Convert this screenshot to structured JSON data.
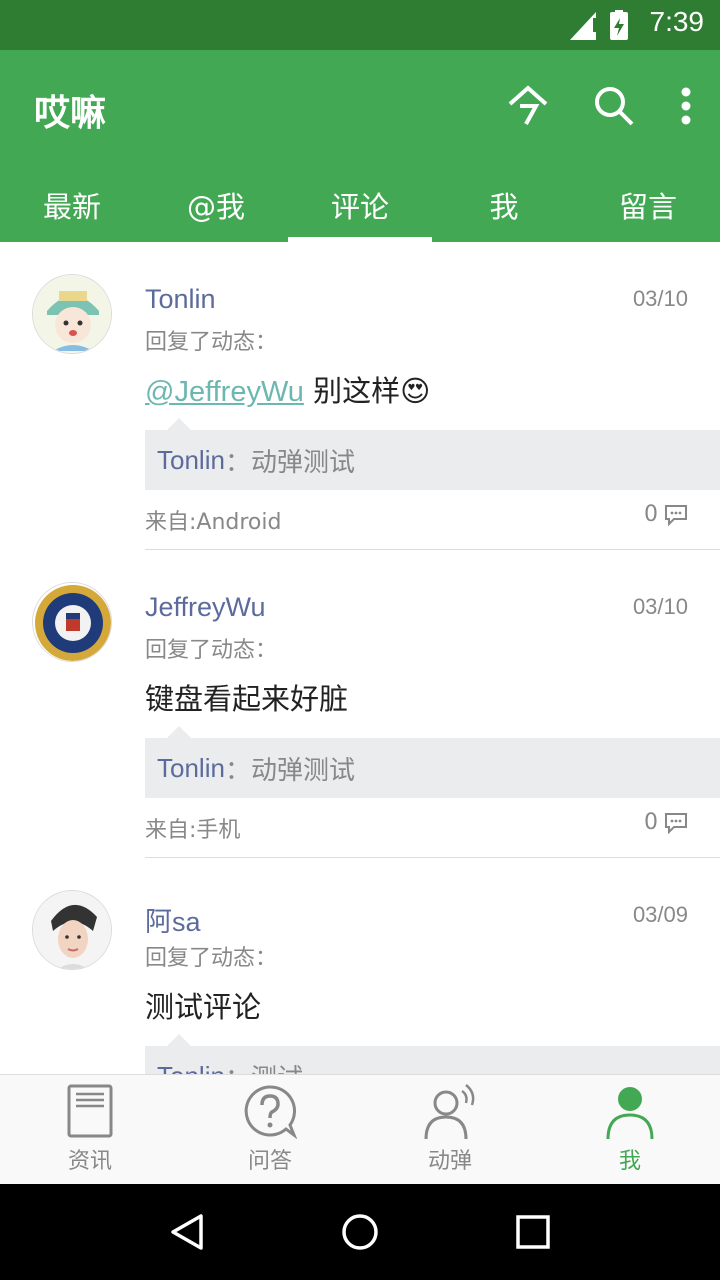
{
  "status_bar": {
    "time": "7:39"
  },
  "app_bar": {
    "title": "哎嘛",
    "actions": [
      {
        "icon": "today-icon",
        "label": "今"
      },
      {
        "icon": "search-icon"
      },
      {
        "icon": "more-vert-icon"
      }
    ]
  },
  "tabs": [
    {
      "label": "最新"
    },
    {
      "label": "@我"
    },
    {
      "label": "评论",
      "active": true
    },
    {
      "label": "我"
    },
    {
      "label": "留言"
    }
  ],
  "feed": [
    {
      "name": "Tonlin",
      "date": "03/10",
      "action": "回复了动态：",
      "mention": "@JeffreyWu",
      "text": " 别这样",
      "emoji": "😍",
      "quote_name": "Tonlin",
      "quote_text": "：动弹测试",
      "source": "来自:Android",
      "comment_count": "0"
    },
    {
      "name": "JeffreyWu",
      "date": "03/10",
      "action": "回复了动态：",
      "text": "键盘看起来好脏",
      "quote_name": "Tonlin",
      "quote_text": "：动弹测试",
      "source": "来自:手机",
      "comment_count": "0"
    },
    {
      "name": "阿sa",
      "date": "03/09",
      "action": "回复了动态：",
      "text": "测试评论",
      "quote_name": "Tonlin",
      "quote_text": "：测试"
    }
  ],
  "bottom_nav": [
    {
      "label": "资讯",
      "icon": "news-icon"
    },
    {
      "label": "问答",
      "icon": "question-icon"
    },
    {
      "label": "动弹",
      "icon": "tweet-icon"
    },
    {
      "label": "我",
      "icon": "profile-icon",
      "active": true
    }
  ],
  "colors": {
    "primary": "#43a854",
    "status_bar": "#2e7d32",
    "name": "#5c6b9c",
    "mention": "#6cb8b0"
  }
}
